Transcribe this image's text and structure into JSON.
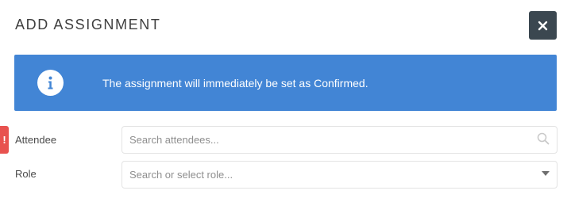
{
  "dialog": {
    "title": "ADD ASSIGNMENT",
    "close_icon": "close-icon"
  },
  "banner": {
    "icon": "info-icon",
    "text": "The assignment will immediately be set as Confirmed.",
    "color": "#4285d5"
  },
  "form": {
    "attendee": {
      "label": "Attendee",
      "placeholder": "Search attendees...",
      "value": "",
      "icon": "search-icon",
      "error_marker": "!"
    },
    "role": {
      "label": "Role",
      "placeholder": "Search or select role...",
      "value": "",
      "icon": "caret-down-icon"
    }
  },
  "colors": {
    "close_button": "#3b4750",
    "error": "#e8524f"
  }
}
